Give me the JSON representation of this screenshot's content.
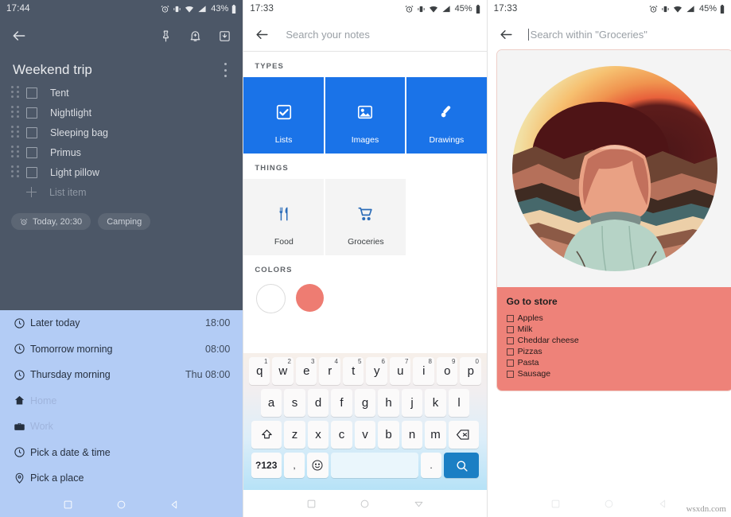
{
  "panel1": {
    "status": {
      "time": "17:44",
      "battery": "43%",
      "icons": [
        "alarm-icon",
        "vibrate-icon",
        "wifi-icon",
        "signal-icon",
        "battery-icon"
      ]
    },
    "appbar": {
      "back": "back-arrow-icon",
      "actions": [
        "pin-icon",
        "add-reminder-bell-icon",
        "archive-icon"
      ]
    },
    "note": {
      "title": "Weekend trip",
      "overflow": "more-options-icon",
      "items": [
        {
          "label": "Tent"
        },
        {
          "label": "Nightlight"
        },
        {
          "label": "Sleeping bag"
        },
        {
          "label": "Primus"
        },
        {
          "label": "Light pillow"
        }
      ],
      "add_item_placeholder": "List item",
      "chips": [
        {
          "icon": "alarm-icon",
          "label": "Today, 20:30"
        },
        {
          "icon": "",
          "label": "Camping"
        }
      ]
    },
    "reminder_sheet": {
      "rows": [
        {
          "icon": "clock-icon",
          "label": "Later today",
          "value": "18:00",
          "dim": false
        },
        {
          "icon": "clock-icon",
          "label": "Tomorrow morning",
          "value": "08:00",
          "dim": false
        },
        {
          "icon": "clock-icon",
          "label": "Thursday morning",
          "value": "Thu 08:00",
          "dim": false
        },
        {
          "icon": "home-icon",
          "label": "Home",
          "value": "",
          "dim": true
        },
        {
          "icon": "briefcase-icon",
          "label": "Work",
          "value": "",
          "dim": true
        },
        {
          "icon": "clock-icon",
          "label": "Pick a date & time",
          "value": "",
          "dim": false
        },
        {
          "icon": "place-pin-icon",
          "label": "Pick a place",
          "value": "",
          "dim": false
        }
      ]
    },
    "navbar": [
      "recents-square-icon",
      "home-circle-icon",
      "back-triangle-icon"
    ]
  },
  "panel2": {
    "status": {
      "time": "17:33",
      "battery": "45%"
    },
    "search": {
      "back": "back-arrow-icon",
      "placeholder": "Search your notes",
      "value": ""
    },
    "sections": {
      "types_header": "TYPES",
      "types": [
        {
          "label": "Lists",
          "icon": "checkbox-checked-icon"
        },
        {
          "label": "Images",
          "icon": "image-icon"
        },
        {
          "label": "Drawings",
          "icon": "brush-icon"
        }
      ],
      "things_header": "THINGS",
      "things": [
        {
          "label": "Food",
          "icon": "cutlery-icon"
        },
        {
          "label": "Groceries",
          "icon": "shopping-cart-icon"
        }
      ],
      "colors_header": "COLORS",
      "colors": [
        {
          "name": "white",
          "hex": "#FFFFFF"
        },
        {
          "name": "salmon",
          "hex": "#EE7C72"
        }
      ]
    },
    "keyboard": {
      "row1": [
        {
          "k": "q",
          "n": "1"
        },
        {
          "k": "w",
          "n": "2"
        },
        {
          "k": "e",
          "n": "3"
        },
        {
          "k": "r",
          "n": "4"
        },
        {
          "k": "t",
          "n": "5"
        },
        {
          "k": "y",
          "n": "6"
        },
        {
          "k": "u",
          "n": "7"
        },
        {
          "k": "i",
          "n": "8"
        },
        {
          "k": "o",
          "n": "9"
        },
        {
          "k": "p",
          "n": "0"
        }
      ],
      "row2": [
        "a",
        "s",
        "d",
        "f",
        "g",
        "h",
        "j",
        "k",
        "l"
      ],
      "row3": [
        "shift-icon",
        "z",
        "x",
        "c",
        "v",
        "b",
        "n",
        "m",
        "backspace-icon"
      ],
      "row4": [
        "?123",
        ",",
        "emoji-icon",
        "",
        ".",
        "search-icon"
      ]
    },
    "navbar": [
      "recents-square-icon",
      "home-circle-icon",
      "back-triangle-icon"
    ]
  },
  "panel3": {
    "status": {
      "time": "17:33",
      "battery": "45%"
    },
    "search": {
      "back": "back-arrow-icon",
      "placeholder": "Search within \"Groceries\"",
      "value": ""
    },
    "note_card": {
      "image_alt": "illustration-woman-watching-sunset-over-mountains",
      "title": "Go to store",
      "accent_hex": "#EE8279",
      "items": [
        {
          "label": "Apples",
          "checked": false
        },
        {
          "label": "Milk",
          "checked": false
        },
        {
          "label": "Cheddar cheese",
          "checked": false
        },
        {
          "label": "Pizzas",
          "checked": false
        },
        {
          "label": "Pasta",
          "checked": false
        },
        {
          "label": "Sausage",
          "checked": false
        }
      ]
    },
    "navbar": [
      "recents-square-icon",
      "home-circle-icon",
      "back-triangle-icon"
    ],
    "watermark": "wsxdn.com"
  }
}
